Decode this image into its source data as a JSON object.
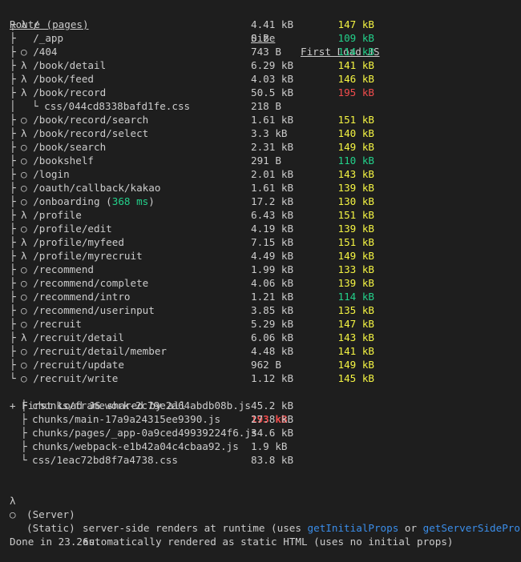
{
  "header": {
    "route": "Route (pages)",
    "size": "Size",
    "first_load": "First Load JS"
  },
  "routes": [
    {
      "tree": "┌",
      "type": "λ",
      "path": "/",
      "size": "4.41 kB",
      "load": "147 kB",
      "color": "yellow"
    },
    {
      "tree": "├",
      "type": " ",
      "path": "/_app",
      "size": "0 B",
      "load": "109 kB",
      "color": "green"
    },
    {
      "tree": "├",
      "type": "○",
      "path": "/404",
      "size": "743 B",
      "load": "114 kB",
      "color": "green"
    },
    {
      "tree": "├",
      "type": "λ",
      "path": "/book/detail",
      "size": "6.29 kB",
      "load": "141 kB",
      "color": "yellow"
    },
    {
      "tree": "├",
      "type": "λ",
      "path": "/book/feed",
      "size": "4.03 kB",
      "load": "146 kB",
      "color": "yellow"
    },
    {
      "tree": "├",
      "type": "λ",
      "path": "/book/record",
      "size": "50.5 kB",
      "load": "195 kB",
      "color": "red"
    },
    {
      "tree": "│",
      "type": "",
      "path": "└ css/044cd8338bafd1fe.css",
      "size": "218 B",
      "load": "",
      "color": "",
      "sub": true
    },
    {
      "tree": "├",
      "type": "○",
      "path": "/book/record/search",
      "size": "1.61 kB",
      "load": "151 kB",
      "color": "yellow"
    },
    {
      "tree": "├",
      "type": "λ",
      "path": "/book/record/select",
      "size": "3.3 kB",
      "load": "140 kB",
      "color": "yellow"
    },
    {
      "tree": "├",
      "type": "○",
      "path": "/book/search",
      "size": "2.31 kB",
      "load": "149 kB",
      "color": "yellow"
    },
    {
      "tree": "├",
      "type": "○",
      "path": "/bookshelf",
      "size": "291 B",
      "load": "110 kB",
      "color": "green"
    },
    {
      "tree": "├",
      "type": "○",
      "path": "/login",
      "size": "2.01 kB",
      "load": "143 kB",
      "color": "yellow"
    },
    {
      "tree": "├",
      "type": "○",
      "path": "/oauth/callback/kakao",
      "size": "1.61 kB",
      "load": "139 kB",
      "color": "yellow"
    },
    {
      "tree": "├",
      "type": "○",
      "path": "/onboarding",
      "ms": "368 ms",
      "size": "17.2 kB",
      "load": "130 kB",
      "color": "yellow"
    },
    {
      "tree": "├",
      "type": "λ",
      "path": "/profile",
      "size": "6.43 kB",
      "load": "151 kB",
      "color": "yellow"
    },
    {
      "tree": "├",
      "type": "○",
      "path": "/profile/edit",
      "size": "4.19 kB",
      "load": "139 kB",
      "color": "yellow"
    },
    {
      "tree": "├",
      "type": "λ",
      "path": "/profile/myfeed",
      "size": "7.15 kB",
      "load": "151 kB",
      "color": "yellow"
    },
    {
      "tree": "├",
      "type": "λ",
      "path": "/profile/myrecruit",
      "size": "4.49 kB",
      "load": "149 kB",
      "color": "yellow"
    },
    {
      "tree": "├",
      "type": "○",
      "path": "/recommend",
      "size": "1.99 kB",
      "load": "133 kB",
      "color": "yellow"
    },
    {
      "tree": "├",
      "type": "○",
      "path": "/recommend/complete",
      "size": "4.06 kB",
      "load": "139 kB",
      "color": "yellow"
    },
    {
      "tree": "├",
      "type": "○",
      "path": "/recommend/intro",
      "size": "1.21 kB",
      "load": "114 kB",
      "color": "green"
    },
    {
      "tree": "├",
      "type": "○",
      "path": "/recommend/userinput",
      "size": "3.85 kB",
      "load": "135 kB",
      "color": "yellow"
    },
    {
      "tree": "├",
      "type": "○",
      "path": "/recruit",
      "size": "5.29 kB",
      "load": "147 kB",
      "color": "yellow"
    },
    {
      "tree": "├",
      "type": "λ",
      "path": "/recruit/detail",
      "size": "6.06 kB",
      "load": "143 kB",
      "color": "yellow"
    },
    {
      "tree": "├",
      "type": "○",
      "path": "/recruit/detail/member",
      "size": "4.48 kB",
      "load": "141 kB",
      "color": "yellow"
    },
    {
      "tree": "├",
      "type": "○",
      "path": "/recruit/update",
      "size": "962 B",
      "load": "149 kB",
      "color": "yellow"
    },
    {
      "tree": "└",
      "type": "○",
      "path": "/recruit/write",
      "size": "1.12 kB",
      "load": "145 kB",
      "color": "yellow"
    }
  ],
  "shared": {
    "label": "+ First Load JS shared by all",
    "load": "193 kB",
    "chunks": [
      {
        "tree": "├",
        "name": "chunks/framework-2c79e2a64abdb08b.js",
        "size": "45.2 kB"
      },
      {
        "tree": "├",
        "name": "chunks/main-17a9a24315ee9390.js",
        "size": "27.8 kB"
      },
      {
        "tree": "├",
        "name": "chunks/pages/_app-0a9ced49939224f6.js",
        "size": "34.6 kB"
      },
      {
        "tree": "├",
        "name": "chunks/webpack-e1b42a04c4cbaa92.js",
        "size": "1.9 kB"
      },
      {
        "tree": "└",
        "name": "css/1eac72bd8f7a4738.css",
        "size": "83.8 kB"
      }
    ]
  },
  "legend": {
    "server_symbol": "λ",
    "server_kind": "(Server)",
    "server_desc_pre": "server-side renders at runtime (uses ",
    "server_fn1": "getInitialProps",
    "server_or": " or ",
    "server_fn2": "getServerSideProps",
    "server_desc_post": ")",
    "static_symbol": "○",
    "static_kind": "(Static)",
    "static_desc": "automatically rendered as static HTML (uses no initial props)"
  },
  "done": "Done in 23.26s.",
  "colors": {
    "background": "#1e1e1e",
    "text": "#cccccc",
    "green": "#23d18b",
    "yellow": "#f5f543",
    "red": "#f14c4c",
    "blue": "#3b8eea"
  }
}
